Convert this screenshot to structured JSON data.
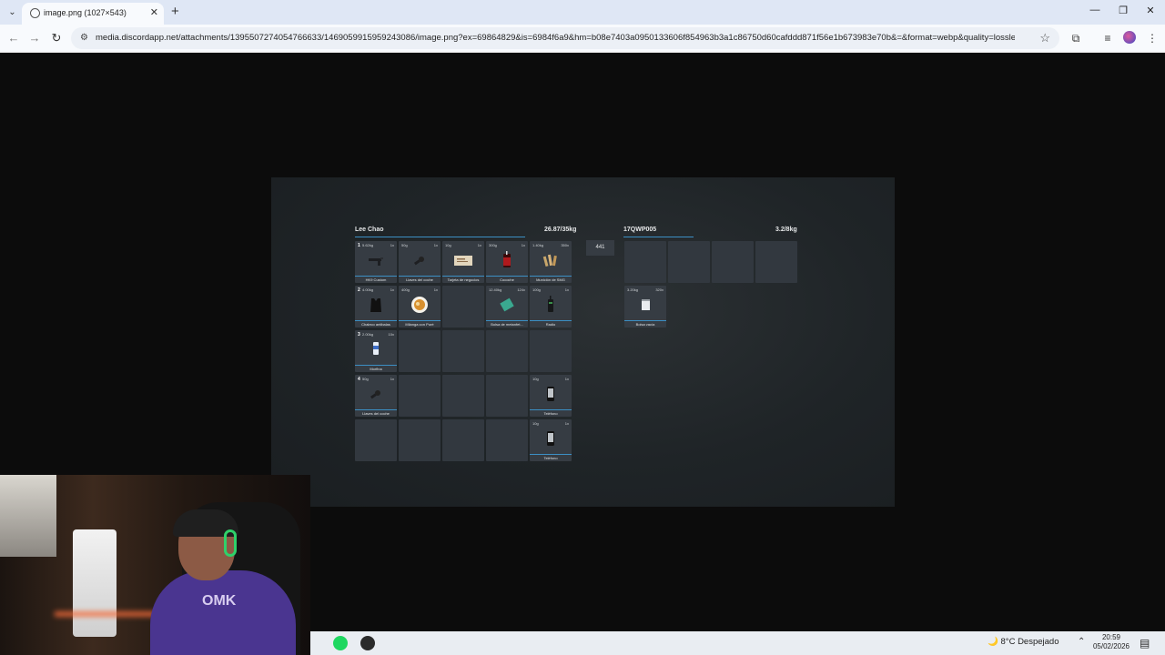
{
  "browser": {
    "tab_title": "image.png (1027×543)",
    "url": "media.discordapp.net/attachments/1395507274054766633/1469059915959243086/image.png?ex=69864829&is=6984f6a9&hm=b08e7403a0950133606f854963b3a1c86750d60cafddd871f56e1b673983e70b&=&format=webp&quality=lossless&wi..."
  },
  "player_inventory": {
    "name": "Lee Chao",
    "weight": "26.87/35kg",
    "slots": [
      {
        "num": "1",
        "weight": "5.62kg",
        "count": "1x",
        "label": "HK9 Custom",
        "icon": "gun-icon"
      },
      {
        "num": "",
        "weight": "50g",
        "count": "1x",
        "label": "Llaves del coche",
        "icon": "key-icon"
      },
      {
        "num": "",
        "weight": "10g",
        "count": "1x",
        "label": "Tarjeta de negocios",
        "icon": "card-icon"
      },
      {
        "num": "",
        "weight": "300g",
        "count": "1x",
        "label": "Cocoche",
        "icon": "drink-icon"
      },
      {
        "num": "",
        "weight": "1.40kg",
        "count": "350x",
        "label": "Munición de SMG",
        "icon": "ammo-icon"
      },
      {
        "num": "2",
        "weight": "4.00kg",
        "count": "1x",
        "label": "Chaleco antibalas",
        "icon": "vest-icon"
      },
      {
        "num": "",
        "weight": "400g",
        "count": "1x",
        "label": "Milanga con Puré",
        "icon": "food-icon"
      },
      {
        "num": "",
        "weight": "",
        "count": "",
        "label": "",
        "icon": ""
      },
      {
        "num": "",
        "weight": "12.40kg",
        "count": "124x",
        "label": "Bolsa de metanfet...",
        "icon": "meth-bag-icon"
      },
      {
        "num": "",
        "weight": "100g",
        "count": "1x",
        "label": "Radio",
        "icon": "radio-icon"
      },
      {
        "num": "3",
        "weight": "2.00kg",
        "count": "10x",
        "label": "Morfina",
        "icon": "morphine-icon"
      },
      {
        "num": "",
        "weight": "",
        "count": "",
        "label": "",
        "icon": ""
      },
      {
        "num": "",
        "weight": "",
        "count": "",
        "label": "",
        "icon": ""
      },
      {
        "num": "",
        "weight": "",
        "count": "",
        "label": "",
        "icon": ""
      },
      {
        "num": "",
        "weight": "",
        "count": "",
        "label": "",
        "icon": ""
      },
      {
        "num": "4",
        "weight": "50g",
        "count": "1x",
        "label": "Llaves del coche",
        "icon": "key-icon"
      },
      {
        "num": "",
        "weight": "",
        "count": "",
        "label": "",
        "icon": ""
      },
      {
        "num": "",
        "weight": "",
        "count": "",
        "label": "",
        "icon": ""
      },
      {
        "num": "",
        "weight": "",
        "count": "",
        "label": "",
        "icon": ""
      },
      {
        "num": "",
        "weight": "10g",
        "count": "1x",
        "label": "Teléfono",
        "icon": "phone-icon"
      },
      {
        "num": "",
        "weight": "",
        "count": "",
        "label": "",
        "icon": ""
      },
      {
        "num": "",
        "weight": "",
        "count": "",
        "label": "",
        "icon": ""
      },
      {
        "num": "",
        "weight": "",
        "count": "",
        "label": "",
        "icon": ""
      },
      {
        "num": "",
        "weight": "",
        "count": "",
        "label": "",
        "icon": ""
      },
      {
        "num": "",
        "weight": "10g",
        "count": "1x",
        "label": "Teléfono",
        "icon": "phone-icon"
      }
    ]
  },
  "amount_input": "441",
  "other_inventory": {
    "name": "17QWP005",
    "weight": "3.2/8kg",
    "slots": [
      {
        "weight": "",
        "count": "",
        "label": "",
        "icon": ""
      },
      {
        "weight": "",
        "count": "",
        "label": "",
        "icon": ""
      },
      {
        "weight": "",
        "count": "",
        "label": "",
        "icon": ""
      },
      {
        "weight": "",
        "count": "",
        "label": "",
        "icon": ""
      },
      {
        "weight": "3.20kg",
        "count": "320x",
        "label": "Bolsa vacía",
        "icon": "empty-bag-icon"
      }
    ]
  },
  "webcam": {
    "shirt_text": "OMK"
  },
  "taskbar": {
    "weather": "8°C  Despejado",
    "time": "20:59",
    "date": "05/02/2026"
  },
  "colors": {
    "accent": "#3c8fc4",
    "slot_bg": "#363c43"
  }
}
